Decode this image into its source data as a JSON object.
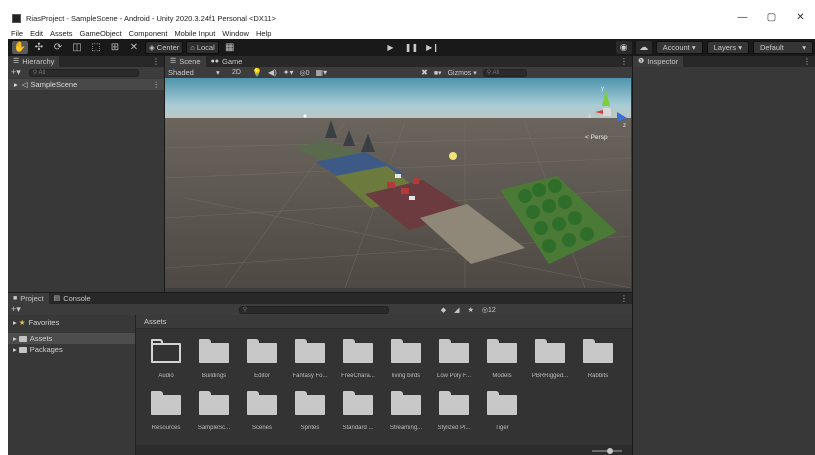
{
  "window": {
    "title": "RiasProject - SampleScene - Android - Unity 2020.3.24f1 Personal <DX11>",
    "minimize": "—",
    "maximize": "▢",
    "close": "✕"
  },
  "menu": [
    "File",
    "Edit",
    "Assets",
    "GameObject",
    "Component",
    "Mobile Input",
    "Window",
    "Help"
  ],
  "toolbar": {
    "pivot_label": "Center",
    "space_label": "Local",
    "account_label": "Account",
    "layers_label": "Layers",
    "layout_label": "Default"
  },
  "hierarchy": {
    "tab_label": "Hierarchy",
    "search_placeholder": "All",
    "scene_name": "SampleScene"
  },
  "scene": {
    "tab_scene": "Scene",
    "tab_game": "Game",
    "shading": "Shaded",
    "mode_2d": "2D",
    "fx_count": "0",
    "gizmos_label": "Gizmos",
    "search_placeholder": "All",
    "persp_label": "< Persp"
  },
  "inspector": {
    "tab_label": "Inspector"
  },
  "project": {
    "tab_project": "Project",
    "tab_console": "Console",
    "favorites": "Favorites",
    "assets": "Assets",
    "packages": "Packages",
    "breadcrumb": "Assets",
    "hidden_count": "12",
    "folders": [
      "Audio",
      "Buildings",
      "Editor",
      "Fantasy Fo...",
      "FreeChara...",
      "living birds",
      "Low Poly F...",
      "Models",
      "PBRRigged...",
      "Rabbits",
      "Resources",
      "SampleSc...",
      "Scenes",
      "Sprites",
      "Standard ...",
      "Streaming...",
      "Stylized Pl...",
      "Tiger"
    ]
  },
  "colors": {
    "accent_blue": "#3a79bb",
    "sky_blue": "#7fb8c9",
    "panel_bg": "#383838",
    "toolbar_bg": "#191919"
  }
}
